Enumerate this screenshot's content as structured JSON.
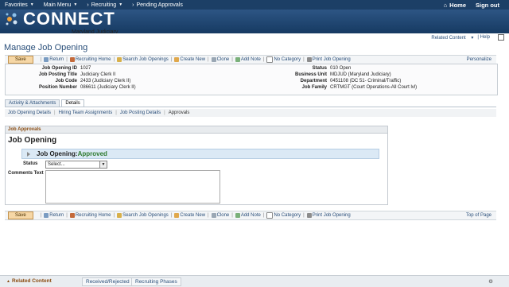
{
  "topnav": {
    "favorites": "Favorites",
    "main_menu": "Main Menu",
    "recruiting": "Recruiting",
    "pending_approvals": "Pending Approvals",
    "home": "Home",
    "sign_out": "Sign out"
  },
  "banner": {
    "logo": "CONNECT",
    "logo_sub": "Maryland Judiciary"
  },
  "subbar": {
    "related_content": "Related Content",
    "help": "Help"
  },
  "page_title": "Manage Job Opening",
  "toolbar": {
    "save": "Save",
    "return": "Return",
    "recruiting_home": "Recruiting Home",
    "search": "Search Job Openings",
    "create_new": "Create New",
    "clone": "Clone",
    "add_note": "Add Note",
    "no_category": "No Category",
    "print": "Print Job Opening",
    "personalize": "Personalize",
    "top_of_page": "Top of Page"
  },
  "summary": {
    "left": [
      {
        "label": "Job Opening ID",
        "value": "1027"
      },
      {
        "label": "Job Posting Title",
        "value": "Judiciary Clerk II"
      },
      {
        "label": "Job Code",
        "value": "2433 (Judiciary Clerk II)"
      },
      {
        "label": "Position Number",
        "value": "086611 (Judiciary Clerk II)"
      }
    ],
    "right": [
      {
        "label": "Status",
        "value": "010 Open"
      },
      {
        "label": "Business Unit",
        "value": "MDJUD (Maryland Judiciary)"
      },
      {
        "label": "Department",
        "value": "0451108 (DC 51- Criminal/Traffic)"
      },
      {
        "label": "Job Family",
        "value": "CRTMGT (Court Operations-All Court lvl)"
      }
    ]
  },
  "tabs": {
    "activity": "Activity & Attachments",
    "details": "Details"
  },
  "pagelinks": {
    "job_opening_details": "Job Opening Details",
    "hiring_team": "Hiring Team Assignments",
    "job_posting": "Job Posting Details",
    "approvals": "Approvals"
  },
  "approvals": {
    "section_header": "Job Approvals",
    "heading": "Job Opening",
    "stage_prefix": "Job Opening:",
    "stage_status": "Approved",
    "status_label": "Status",
    "status_value": "Select...",
    "comments_label": "Comments Text"
  },
  "bottombar": {
    "related_content": "Related Content",
    "tab1": "Received/Rejected",
    "tab2": "Recruiting Phases"
  }
}
